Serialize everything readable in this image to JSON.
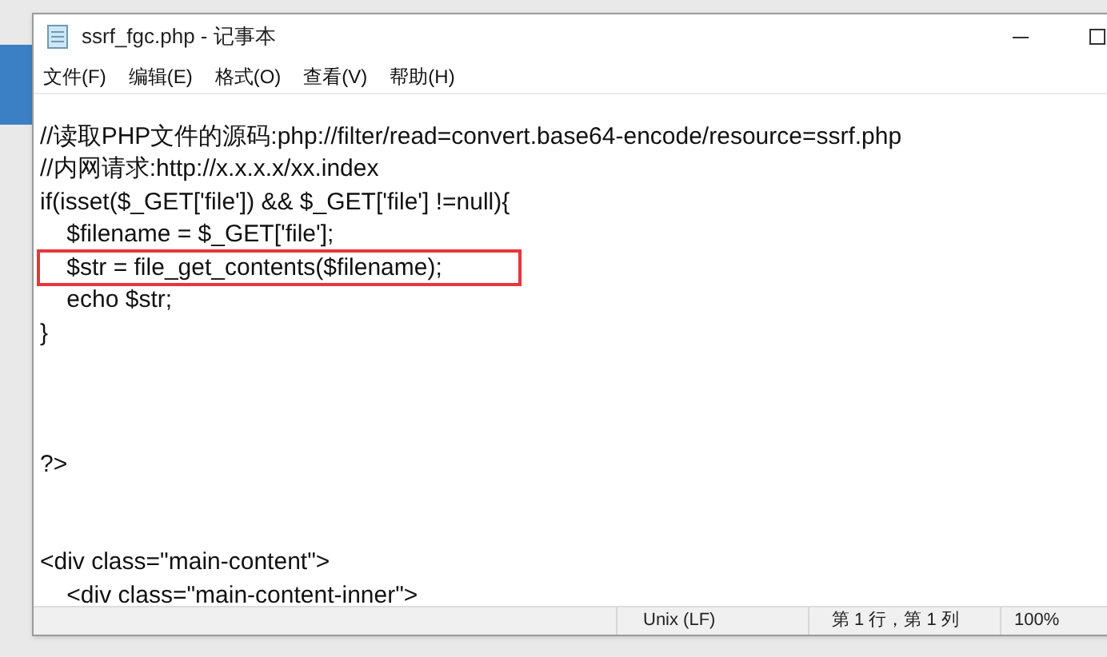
{
  "window": {
    "title": "ssrf_fgc.php - 记事本"
  },
  "menu": [
    "文件(F)",
    "编辑(E)",
    "格式(O)",
    "查看(V)",
    "帮助(H)"
  ],
  "lines": [
    {
      "kind": "code",
      "text": "//读取PHP文件的源码:php://filter/read=convert.base64-encode/resource=ssrf.php",
      "highlighted": false
    },
    {
      "kind": "code",
      "text": "//内网请求:http://x.x.x.x/xx.index",
      "highlighted": false
    },
    {
      "kind": "code",
      "text": "if(isset($_GET['file']) && $_GET['file'] !=null){",
      "highlighted": false
    },
    {
      "kind": "code",
      "text": "    $filename = $_GET['file'];",
      "highlighted": false
    },
    {
      "kind": "code",
      "text": "    $str = file_get_contents($filename);",
      "highlighted": true
    },
    {
      "kind": "code",
      "text": "    echo $str;",
      "highlighted": false
    },
    {
      "kind": "code",
      "text": "}",
      "highlighted": false
    },
    {
      "kind": "blank"
    },
    {
      "kind": "blank"
    },
    {
      "kind": "blank"
    },
    {
      "kind": "code",
      "text": "?>",
      "highlighted": false
    },
    {
      "kind": "blank"
    },
    {
      "kind": "blank"
    },
    {
      "kind": "code",
      "text": "<div class=\"main-content\">",
      "highlighted": false
    },
    {
      "kind": "code",
      "text": "    <div class=\"main-content-inner\">",
      "highlighted": false
    }
  ],
  "status_bar": {
    "line_ending": "Unix (LF)",
    "position": "第 1 行，第 1 列",
    "zoom": "100%"
  }
}
